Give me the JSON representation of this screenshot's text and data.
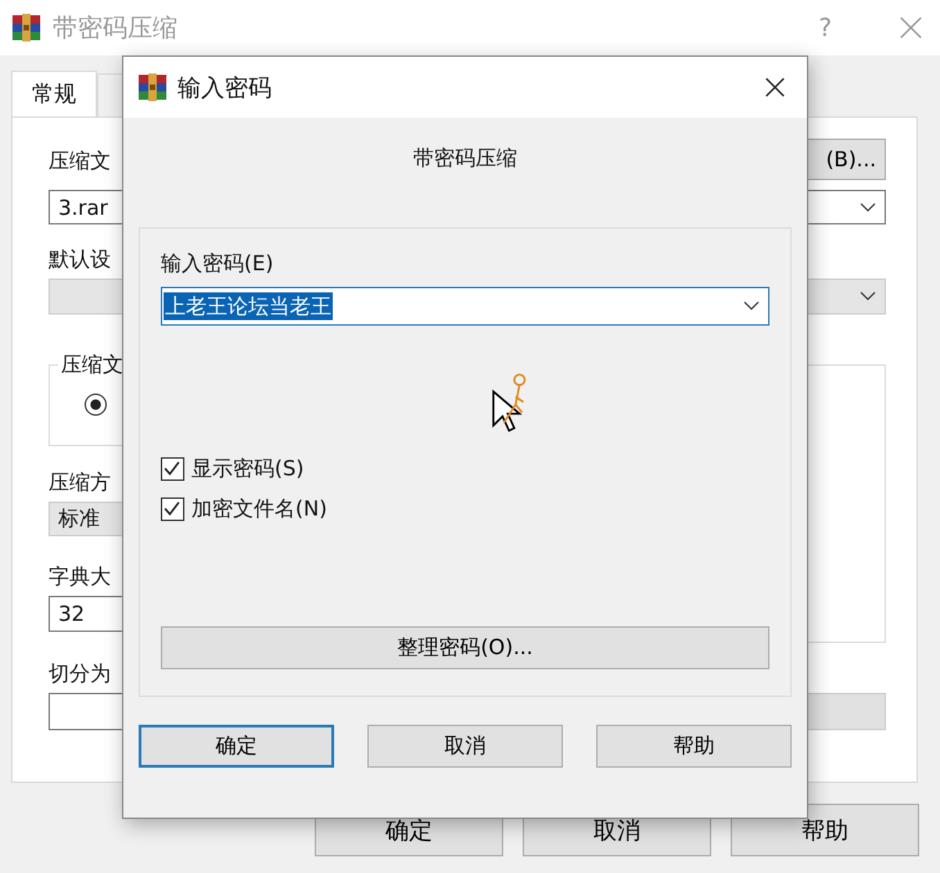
{
  "main_window": {
    "title": "带密码压缩",
    "help": "?",
    "tabs": [
      {
        "label": "常规",
        "selected": true
      },
      {
        "selected": false
      }
    ],
    "archive_label": "压缩文",
    "browse_button": "(B)...",
    "archive_value": "3.rar",
    "profile_label": "默认设",
    "group_label": "压缩文",
    "radio_selected": true,
    "method_label": "压缩方",
    "method_value": "标准",
    "dict_label": "字典大",
    "dict_value": "32",
    "split_label": "切分为",
    "buttons": [
      {
        "label": "确定"
      },
      {
        "label": "取消"
      },
      {
        "label": "帮助"
      }
    ]
  },
  "dialog": {
    "title": "输入密码",
    "subtitle": "带密码压缩",
    "password_label": "输入密码(E)",
    "password_value": "上老王论坛当老王",
    "password_selected": true,
    "checkboxes": [
      {
        "label": "显示密码(S)",
        "checked": true
      },
      {
        "label": "加密文件名(N)",
        "checked": true
      }
    ],
    "organize_button": "整理密码(O)...",
    "buttons": [
      {
        "label": "确定",
        "default": true
      },
      {
        "label": "取消",
        "default": false
      },
      {
        "label": "帮助",
        "default": false
      }
    ]
  }
}
